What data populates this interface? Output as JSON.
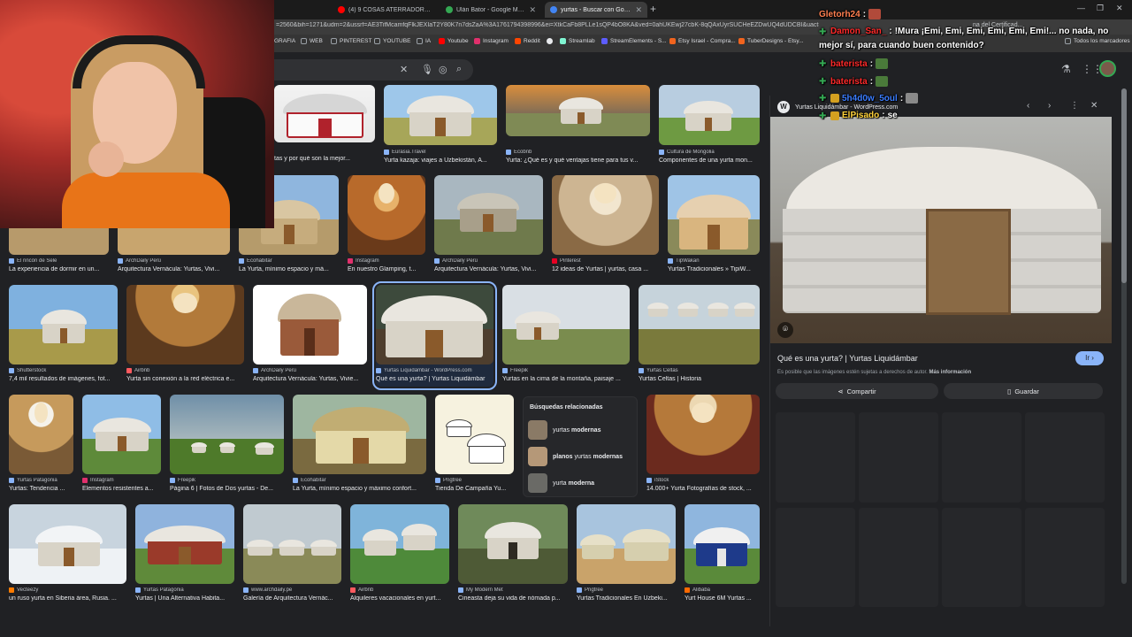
{
  "browser": {
    "tabs": [
      {
        "title": "(4) 9 COSAS ATERRADORAS VI",
        "color": "#ff0000"
      },
      {
        "title": "Ulán Bator - Google Maps",
        "color": "#34a853"
      },
      {
        "title": "yurtas - Buscar con Google",
        "color": "#4285f4"
      }
    ],
    "new_tab": "+",
    "url": "=2560&bih=1271&udm=2&ussrf=AE3TifMcamfqFlkJEXIaT2Y80K7n7dsZaA%3A1761794398996&ei=XtkCaFb8PLLe1sQP4bO8KA&ved=0ahUKEwj27cbK-8qQAxUyrSUCHeEZDwUQ4dUDCBI&uact=5&oq",
    "url_right": "na del Certificad...",
    "bookmarks": [
      {
        "label": "GRAFIA",
        "color": "#9aa0a6"
      },
      {
        "label": "WEB",
        "color": "#9aa0a6"
      },
      {
        "label": "PINTEREST",
        "color": "#9aa0a6"
      },
      {
        "label": "YOUTUBE",
        "color": "#9aa0a6"
      },
      {
        "label": "IA",
        "color": "#9aa0a6"
      },
      {
        "label": "Youtube",
        "color": "#ff0000"
      },
      {
        "label": "Instagram",
        "color": "#e1306c"
      },
      {
        "label": "Reddit",
        "color": "#ff4500"
      },
      {
        "label": "Streamlab",
        "color": "#80f5d2"
      },
      {
        "label": "StreamElements - S...",
        "color": "#5d5dff"
      },
      {
        "label": "Etsy Israel - Compra...",
        "color": "#f1641e"
      },
      {
        "label": "TuberDesigns - Etsy...",
        "color": "#f1641e"
      },
      {
        "label": "Todos los marcadores",
        "color": "#9aa0a6"
      }
    ]
  },
  "results": [
    {
      "source": "",
      "caption": "tas y por qué son la mejor..."
    },
    {
      "source": "Eurasia.Travel",
      "caption": "Yurta kazaja: viajes a Uzbekistán, A..."
    },
    {
      "source": "Ecobnb",
      "caption": "Yurta: ¿Qué es y qué ventajas tiene para tus v..."
    },
    {
      "source": "Cultura de Mongolia",
      "caption": "Componentes de una yurta mon..."
    },
    {
      "source": "El rincón de Sele",
      "caption": "La experiencia de dormir en un..."
    },
    {
      "source": "ArchDaily Perú",
      "caption": "Arquitectura Vernácula: Yurtas, Vivi..."
    },
    {
      "source": "Ecohabitar",
      "caption": "La Yurta, mínimo espacio y má..."
    },
    {
      "source": "Instagram",
      "caption": "En nuestro Glamping, t..."
    },
    {
      "source": "ArchDaily Perú",
      "caption": "Arquitectura Vernácula: Yurtas, Vivi..."
    },
    {
      "source": "Pinterest",
      "caption": "12 ideas de Yurtas | yurtas, casa ..."
    },
    {
      "source": "TipWakan",
      "caption": "Yurtas Tradicionales » TipiW..."
    },
    {
      "source": "Shutterstock",
      "caption": "7,4 mil resultados de imágenes, fot..."
    },
    {
      "source": "Airbnb",
      "caption": "Yurta sin conexión a la red eléctrica e..."
    },
    {
      "source": "ArchDaily Perú",
      "caption": "Arquitectura Vernácula: Yurtas, Vivie..."
    },
    {
      "source": "Yurtas Liquidámbar - WordPress.com",
      "caption": "Qué es una yurta? | Yurtas Liquidámbar"
    },
    {
      "source": "Freepik",
      "caption": "Yurtas en la cima de la montaña, paisaje ..."
    },
    {
      "source": "Yurtas Celtas",
      "caption": "Yurtas Celtas | Historia"
    },
    {
      "source": "Yurtas Patagonia",
      "caption": "Yurtas: Tendencia ..."
    },
    {
      "source": "Instagram",
      "caption": "Elementos resistentes a..."
    },
    {
      "source": "Freepik",
      "caption": "Página 6 | Fotos de Dos yurtas - De..."
    },
    {
      "source": "Ecohabitar",
      "caption": "La Yurta, mínimo espacio y máximo confort..."
    },
    {
      "source": "Pngtree",
      "caption": "Tienda De Campaña Yu..."
    },
    {
      "source": "iStock",
      "caption": "14.000+ Yurta Fotografías de stock, ..."
    },
    {
      "source": "Vecteezy",
      "caption": "un ruso yurta en Siberia área, Rusia. ..."
    },
    {
      "source": "Yurtas Patagonia",
      "caption": "Yurtas | Una Alternativa Habita..."
    },
    {
      "source": "www.archdaily.pe",
      "caption": "Galería de Arquitectura Vernác..."
    },
    {
      "source": "Airbnb",
      "caption": "Alquileres vacacionales en yurt..."
    },
    {
      "source": "My Modern Met",
      "caption": "Cineasta deja su vida de nómada p..."
    },
    {
      "source": "Pngtree",
      "caption": "Yurtas Tradicionales En Uzbeki..."
    },
    {
      "source": "Alibaba",
      "caption": "Yurt House 6M Yurtas ..."
    }
  ],
  "related": {
    "title": "Búsquedas relacionadas",
    "items": [
      {
        "pre": "yurtas ",
        "bold": "modernas",
        "post": ""
      },
      {
        "pre": "",
        "bold": "planos",
        "post": " yurtas ",
        "bold2": "modernas"
      },
      {
        "pre": "yurta ",
        "bold": "moderna",
        "post": ""
      }
    ]
  },
  "panel": {
    "site": "Yurtas Liquidámbar - WordPress.com",
    "title": "Qué es una yurta? | Yurtas Liquidámbar",
    "visit": "Ir",
    "note": "Es posible que las imágenes estén sujetas a derechos de autor.",
    "note_link": "Más información",
    "share": "Compartir",
    "save": "Guardar"
  },
  "chat": [
    {
      "user": "Gletorh24",
      "color": "#ff7f50",
      "text": ""
    },
    {
      "user": "Damon_San_",
      "color": "#ff2a2a",
      "text": "!Mura ¡Emi, Emi, Emi, Emi, Emi, Emi!... no nada, no"
    },
    {
      "user": "",
      "color": "#ffffff",
      "text": "mejor sí, para cuando buen contenido?"
    },
    {
      "user": "bateristа",
      "color": "#ff2a2a",
      "text": ""
    },
    {
      "user": "bateristа",
      "color": "#ff2a2a",
      "text": ""
    },
    {
      "user": "5h4d0w_5oul",
      "color": "#3b7dff",
      "text": ""
    },
    {
      "user": "ElPisado",
      "color": "#ffd23b",
      "text": "se"
    }
  ]
}
